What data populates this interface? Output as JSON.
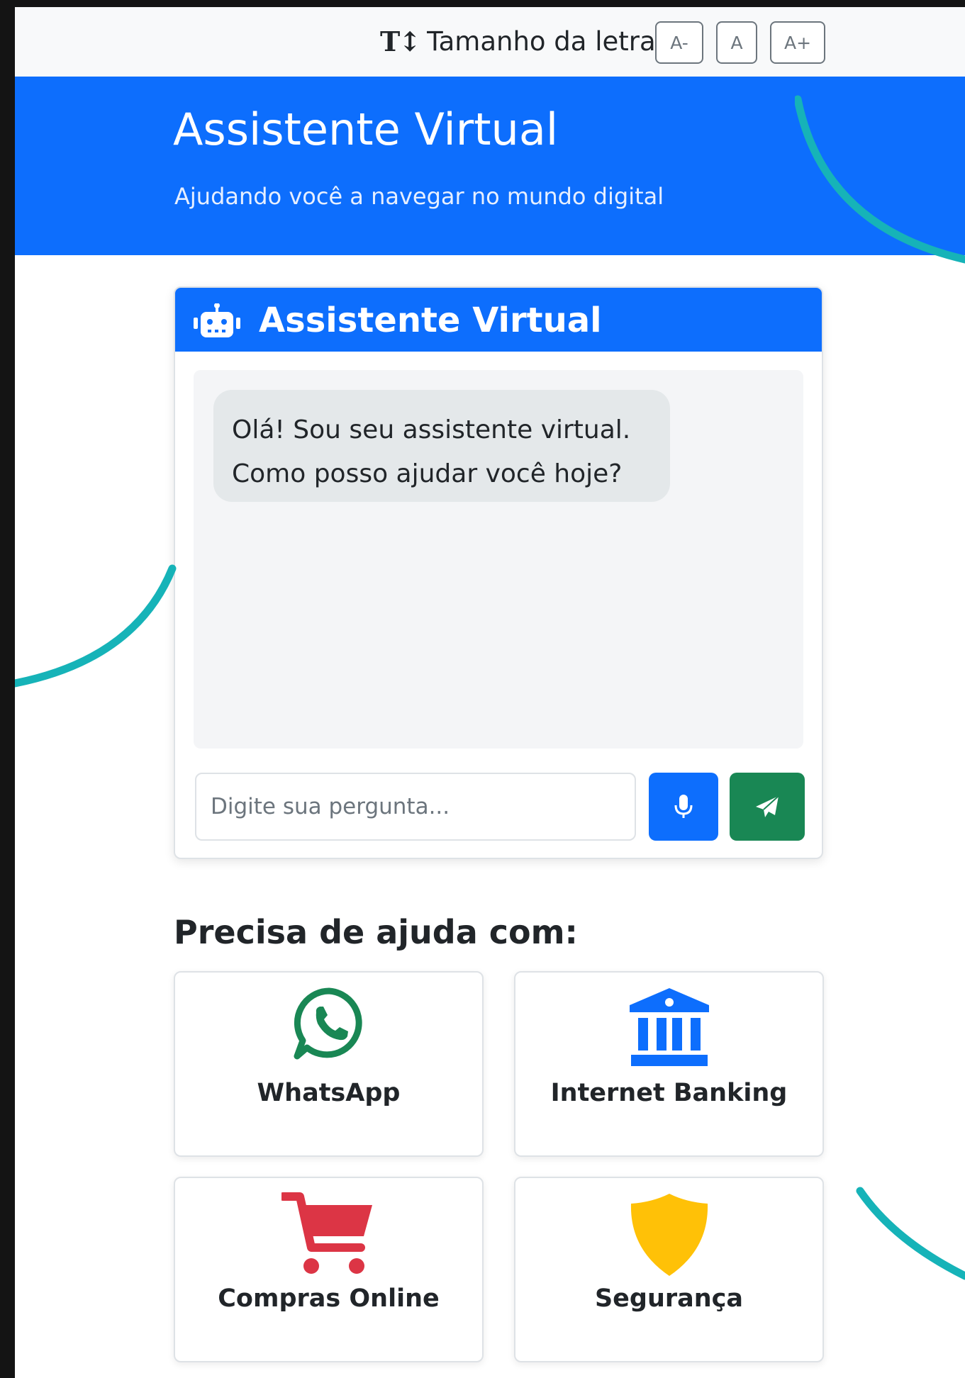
{
  "font_bar": {
    "label": "Tamanho da letra:",
    "decrease_label": "A-",
    "reset_label": "A",
    "increase_label": "A+"
  },
  "header": {
    "title": "Assistente Virtual",
    "subtitle": "Ajudando você a navegar no mundo digital"
  },
  "chat": {
    "title": "Assistente Virtual",
    "messages": [
      {
        "sender": "bot",
        "lines": [
          "Olá! Sou seu assistente virtual.",
          "Como posso ajudar você hoje?"
        ]
      }
    ],
    "input_placeholder": "Digite sua pergunta...",
    "mic_icon": "microphone-icon",
    "send_icon": "paper-plane-icon"
  },
  "help": {
    "heading": "Precisa de ajuda com:",
    "items": [
      {
        "label": "WhatsApp",
        "icon": "whatsapp-icon",
        "color": "#198754"
      },
      {
        "label": "Internet Banking",
        "icon": "bank-icon",
        "color": "#0d6efd"
      },
      {
        "label": "Compras Online",
        "icon": "cart-icon",
        "color": "#dc3545"
      },
      {
        "label": "Segurança",
        "icon": "shield-icon",
        "color": "#ffc107"
      }
    ]
  },
  "colors": {
    "primary": "#0d6efd",
    "success": "#198754",
    "danger": "#dc3545",
    "warning": "#ffc107",
    "accent_swirl": "#16b3b8"
  }
}
